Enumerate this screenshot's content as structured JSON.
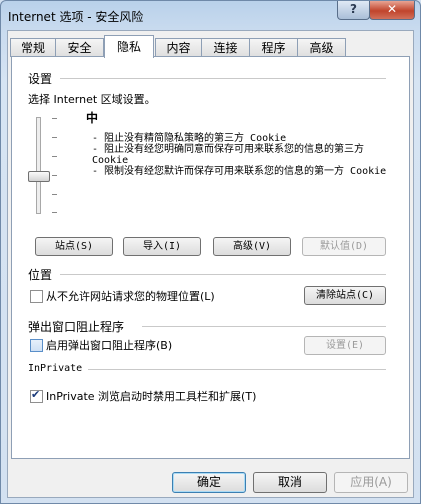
{
  "window": {
    "title": "Internet 选项 - 安全风险",
    "help_label": "?",
    "close_label": "✕"
  },
  "tabs": [
    {
      "label": "常规"
    },
    {
      "label": "安全"
    },
    {
      "label": "隐私"
    },
    {
      "label": "内容"
    },
    {
      "label": "连接"
    },
    {
      "label": "程序"
    },
    {
      "label": "高级"
    }
  ],
  "active_tab": "隐私",
  "settings": {
    "heading": "设置",
    "zone_prompt": "选择 Internet 区域设置。",
    "level": "中",
    "bullets": [
      "- 阻止没有精简隐私策略的第三方 Cookie",
      "- 阻止没有经您明确同意而保存可用来联系您的信息的第三方 Cookie",
      "- 限制没有经您默许而保存可用来联系您的信息的第一方 Cookie"
    ],
    "buttons": {
      "sites": "站点(S)",
      "import": "导入(I)",
      "advanced": "高级(V)",
      "default": "默认值(D)"
    }
  },
  "location": {
    "heading": "位置",
    "checkbox_label": "从不允许网站请求您的物理位置(L)",
    "checked": false,
    "clear_button": "清除站点(C)"
  },
  "popup": {
    "heading": "弹出窗口阻止程序",
    "checkbox_label": "启用弹出窗口阻止程序(B)",
    "checked": false,
    "settings_button": "设置(E)"
  },
  "inprivate": {
    "heading": "InPrivate",
    "checkbox_label": "InPrivate 浏览启动时禁用工具栏和扩展(T)",
    "checked": true
  },
  "footer": {
    "ok": "确定",
    "cancel": "取消",
    "apply": "应用(A)"
  }
}
